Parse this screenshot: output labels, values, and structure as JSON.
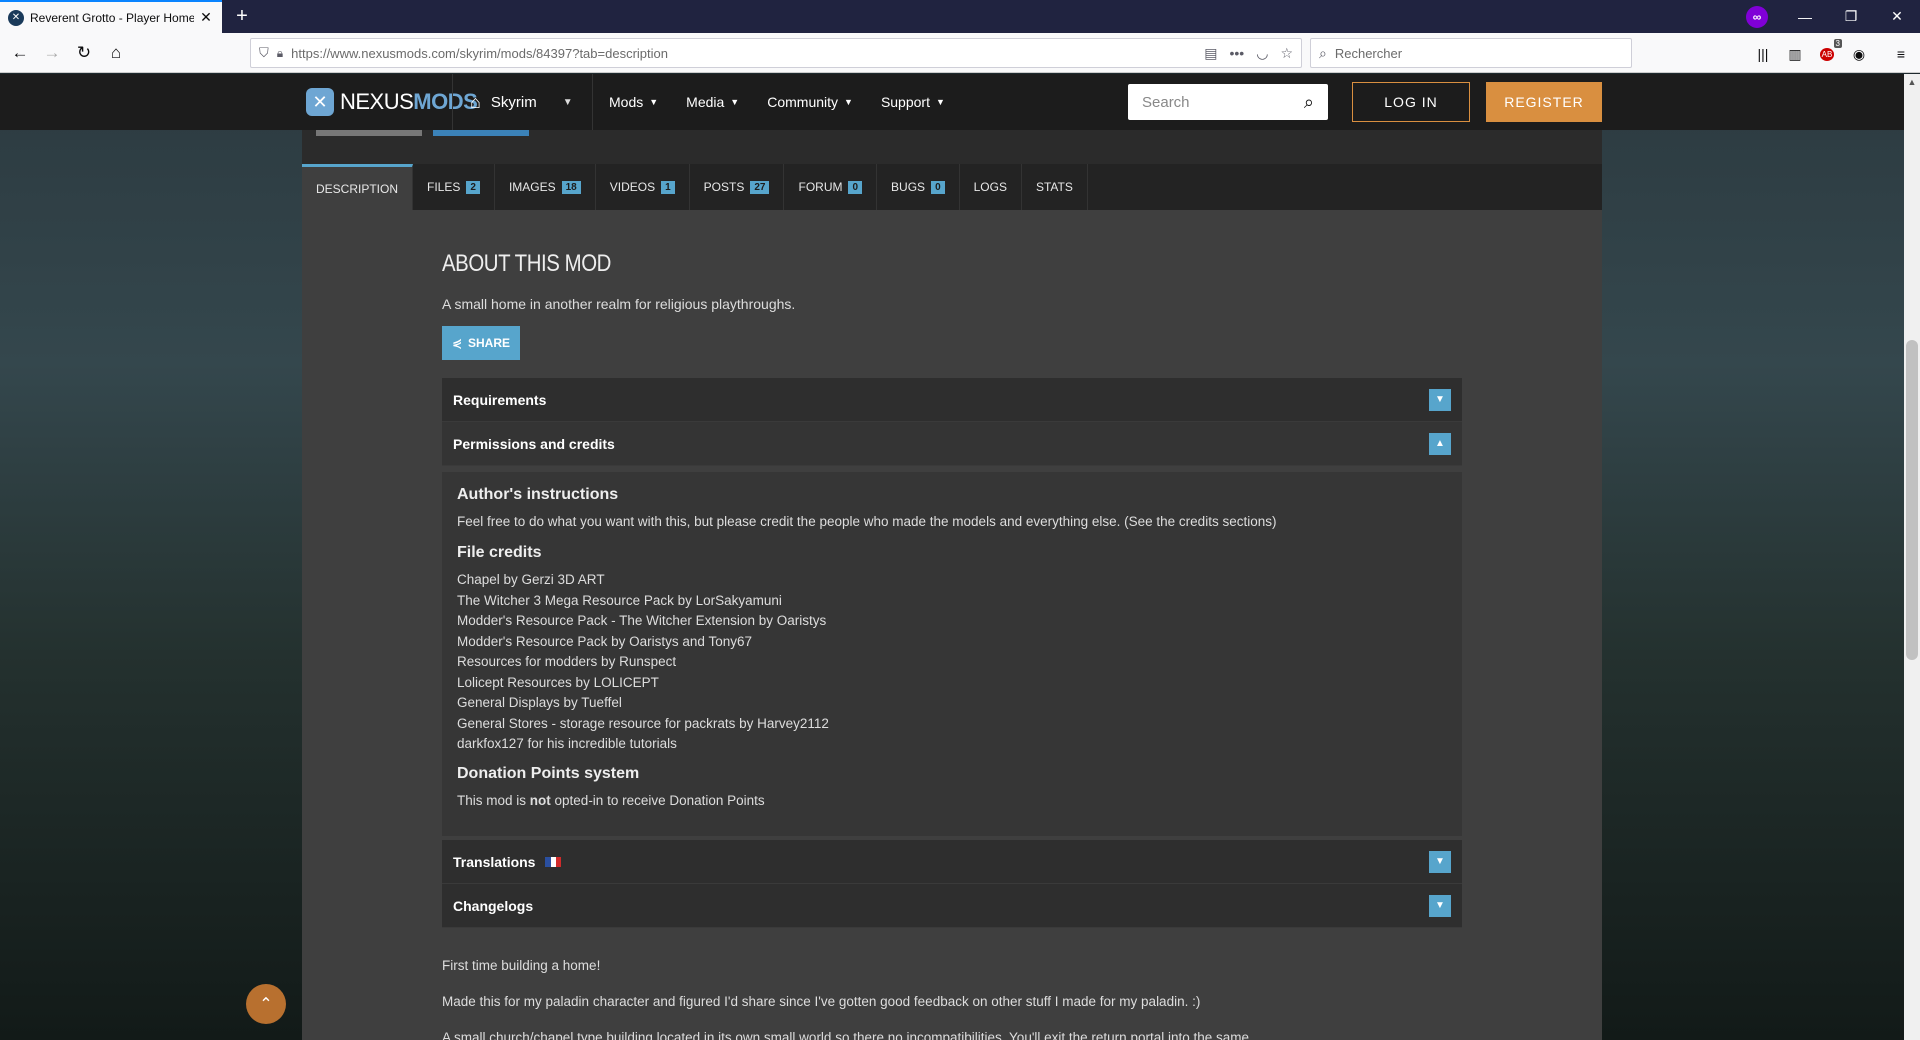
{
  "browser": {
    "tab_title": "Reverent Grotto - Player Home",
    "url_host": "https://www.nexusmods.com",
    "url_path": "/skyrim/mods/84397?tab=description",
    "search_placeholder": "Rechercher",
    "abp_count": "3"
  },
  "header": {
    "logo_a": "NEXUS",
    "logo_b": "MODS",
    "game": "Skyrim",
    "menu": [
      "Mods",
      "Media",
      "Community",
      "Support"
    ],
    "search_placeholder": "Search",
    "login": "LOG IN",
    "register": "REGISTER"
  },
  "tabs": [
    {
      "label": "DESCRIPTION",
      "count": null
    },
    {
      "label": "FILES",
      "count": "2"
    },
    {
      "label": "IMAGES",
      "count": "18"
    },
    {
      "label": "VIDEOS",
      "count": "1"
    },
    {
      "label": "POSTS",
      "count": "27"
    },
    {
      "label": "FORUM",
      "count": "0"
    },
    {
      "label": "BUGS",
      "count": "0"
    },
    {
      "label": "LOGS",
      "count": null
    },
    {
      "label": "STATS",
      "count": null
    }
  ],
  "about": {
    "title": "ABOUT THIS MOD",
    "subtitle": "A small home in another realm for religious playthroughs.",
    "share": "SHARE"
  },
  "accordion": {
    "requirements": "Requirements",
    "permissions": "Permissions and credits",
    "translations": "Translations",
    "changelogs": "Changelogs"
  },
  "permissions": {
    "author_heading": "Author's instructions",
    "author_text": "Feel free to do what you want with this, but please credit the people who made the models and everything else. (See the credits sections)",
    "credits_heading": "File credits",
    "credits": [
      "Chapel by Gerzi 3D ART",
      "The Witcher 3 Mega Resource Pack by LorSakyamuni",
      "Modder's Resource Pack - The Witcher Extension by Oaristys",
      "Modder's Resource Pack by Oaristys and Tony67",
      "Resources for modders by Runspect",
      "Lolicept Resources by LOLICEPT",
      "General Displays by Tueffel",
      "General Stores - storage resource for packrats by Harvey2112",
      "darkfox127 for his incredible tutorials"
    ],
    "donation_heading": "Donation Points system",
    "donation_pre": "This mod is ",
    "donation_bold": "not",
    "donation_post": " opted-in to receive Donation Points"
  },
  "description": {
    "p1": "First time building a home!",
    "p2": "Made this for my paladin character and figured I'd share since I've gotten good feedback on other stuff I made for my paladin. :)",
    "p3": "A small church/chapel type building located in its own small world so there no incompatibilities. You'll exit the return portal into the same"
  },
  "colors": {
    "accent": "#57a5cc",
    "orange": "#d98f40"
  }
}
